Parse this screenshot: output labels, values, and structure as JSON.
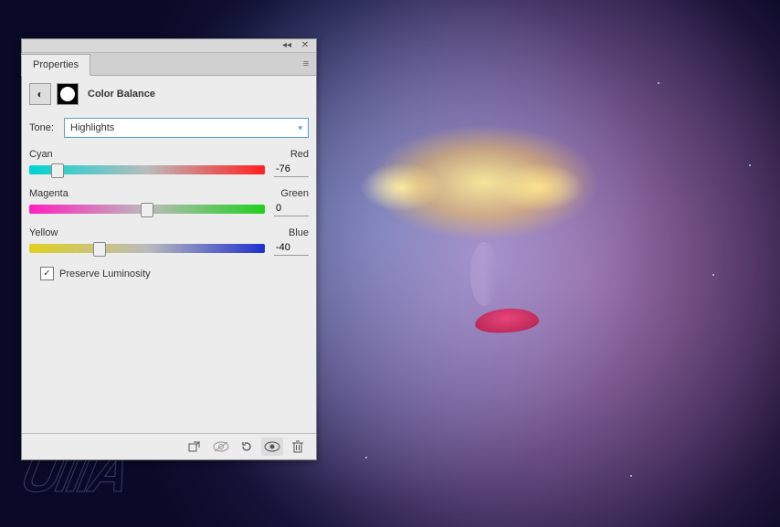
{
  "panel": {
    "tab_label": "Properties",
    "adjustment_title": "Color Balance",
    "tone_label": "Tone:",
    "tone_value": "Highlights",
    "sliders": [
      {
        "left": "Cyan",
        "right": "Red",
        "value": "-76",
        "pos": 12
      },
      {
        "left": "Magenta",
        "right": "Green",
        "value": "0",
        "pos": 50
      },
      {
        "left": "Yellow",
        "right": "Blue",
        "value": "-40",
        "pos": 30
      }
    ],
    "preserve_label": "Preserve Luminosity",
    "preserve_checked": true
  },
  "footer_icons": {
    "clip": "clip-to-layer",
    "prev": "view-previous",
    "reset": "reset",
    "vis": "toggle-visibility",
    "trash": "delete"
  },
  "watermark": "UIIIA"
}
